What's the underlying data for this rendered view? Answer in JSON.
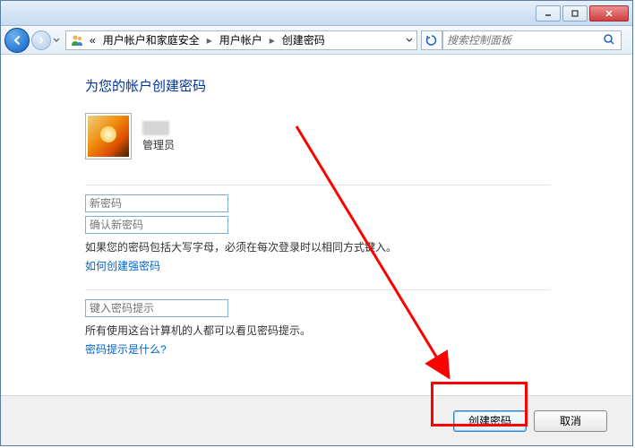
{
  "breadcrumbs": {
    "prefix": "«",
    "item1": "用户帐户和家庭安全",
    "item2": "用户帐户",
    "item3": "创建密码"
  },
  "search": {
    "placeholder": "搜索控制面板"
  },
  "page": {
    "title": "为您的帐户创建密码"
  },
  "user": {
    "role": "管理员"
  },
  "fields": {
    "new_password_placeholder": "新密码",
    "confirm_password_placeholder": "确认新密码",
    "hint_placeholder": "键入密码提示"
  },
  "text": {
    "caps_warning": "如果您的密码包括大写字母，必须在每次登录时以相同方式键入。",
    "hint_visible": "所有使用这台计算机的人都可以看见密码提示。"
  },
  "links": {
    "strong_password": "如何创建强密码",
    "what_is_hint": "密码提示是什么?"
  },
  "buttons": {
    "create": "创建密码",
    "cancel": "取消"
  }
}
